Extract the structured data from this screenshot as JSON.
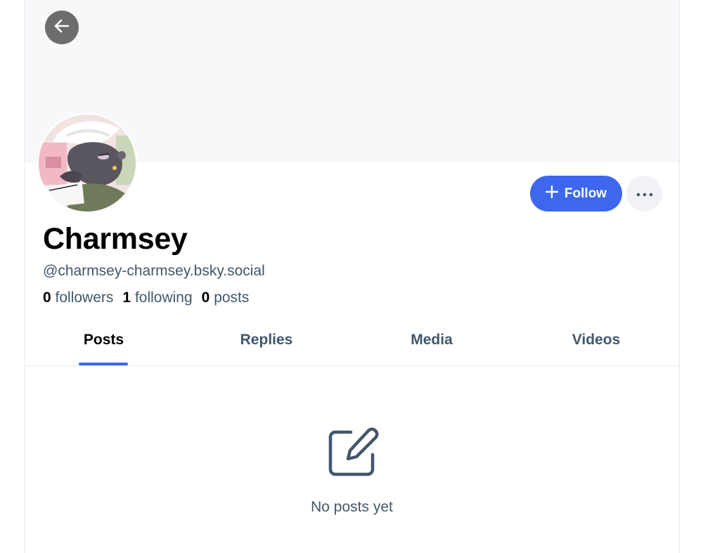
{
  "profile": {
    "display_name": "Charmsey",
    "handle": "@charmsey-charmsey.bsky.social",
    "stats": {
      "followers_count": "0",
      "followers_label": "followers",
      "following_count": "1",
      "following_label": "following",
      "posts_count": "0",
      "posts_label": "posts"
    }
  },
  "actions": {
    "follow_label": "Follow",
    "follow_icon": "plus-icon",
    "more_icon": "ellipsis-icon",
    "back_icon": "arrow-left-icon"
  },
  "tabs": [
    {
      "label": "Posts",
      "active": true
    },
    {
      "label": "Replies",
      "active": false
    },
    {
      "label": "Media",
      "active": false
    },
    {
      "label": "Videos",
      "active": false
    }
  ],
  "empty_state": {
    "icon": "edit-icon",
    "message": "No posts yet"
  },
  "colors": {
    "accent": "#3e67ef",
    "muted_text": "#42576c",
    "banner": "#f7f8fa",
    "back_button": "#6d6d6d"
  }
}
